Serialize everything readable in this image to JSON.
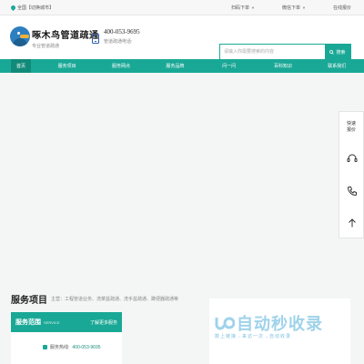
{
  "topbar": {
    "location": "全国【切换城市】",
    "links": [
      {
        "label": "扫码下单"
      },
      {
        "label": "微信下单"
      },
      {
        "label": "在线报价"
      }
    ]
  },
  "header": {
    "brand_name": "啄木鸟管道疏通",
    "brand_sub": "专业管道疏通",
    "phone_number": "400-053-9695",
    "phone_label": "管道疏通电话:",
    "search_placeholder": "请输入你需要搜索的内容",
    "search_button": "搜索"
  },
  "nav": {
    "items": [
      {
        "label": "首页"
      },
      {
        "label": "服务项目"
      },
      {
        "label": "服务网点"
      },
      {
        "label": "服务品牌"
      },
      {
        "label": "问一问"
      },
      {
        "label": "百科知识"
      },
      {
        "label": "联系我们"
      }
    ]
  },
  "sidebar": {
    "quick_line1": "快速",
    "quick_line2": "报价"
  },
  "services": {
    "title": "服务项目",
    "subtitle": "主营：工程管道业务、洗菜盆疏通、洗手盆疏通、蹲便器疏通等",
    "card_title": "服务范围",
    "card_en": "SERVICE",
    "card_more": "了解更多服务",
    "hotline_label": "服务热线:",
    "hotline_number": "400-053-9695"
  },
  "watermark": {
    "big": "自动秒收录",
    "small": "数上链接→来访一次→自动收录"
  },
  "colors": {
    "accent": "#1aa896",
    "accent_dark": "#128a79"
  }
}
